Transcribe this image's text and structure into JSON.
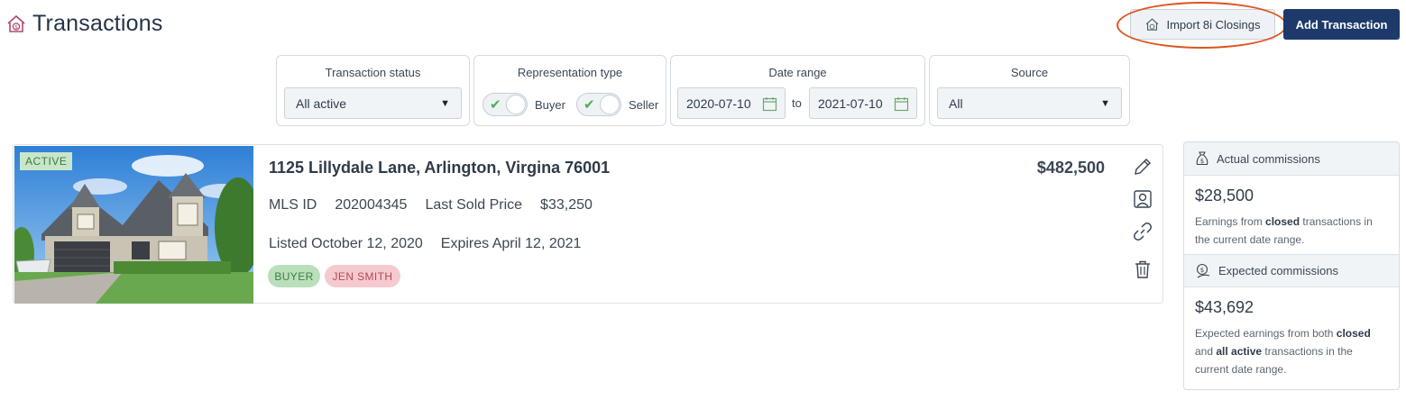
{
  "header": {
    "title": "Transactions",
    "import_label": "Import 8i Closings",
    "add_label": "Add Transaction"
  },
  "filters": {
    "status": {
      "label": "Transaction status",
      "value": "All active"
    },
    "representation": {
      "label": "Representation type",
      "buyer_label": "Buyer",
      "seller_label": "Seller",
      "buyer_on": true,
      "seller_on": true
    },
    "date_range": {
      "label": "Date range",
      "from": "2020-07-10",
      "to_word": "to",
      "to": "2021-07-10"
    },
    "source": {
      "label": "Source",
      "value": "All"
    }
  },
  "transaction": {
    "status": "ACTIVE",
    "address": "1125 Lillydale Lane, Arlington, Virgina 76001",
    "price": "$482,500",
    "mls_label": "MLS ID",
    "mls_id": "202004345",
    "last_sold_label": "Last Sold Price",
    "last_sold": "$33,250",
    "listed": "Listed October 12, 2020",
    "expires": "Expires April 12, 2021",
    "chips": [
      "BUYER",
      "JEN SMITH"
    ]
  },
  "commissions": {
    "actual": {
      "title": "Actual commissions",
      "amount": "$28,500",
      "desc_pre": "Earnings from ",
      "desc_bold": "closed",
      "desc_post": " transactions in the current date range."
    },
    "expected": {
      "title": "Expected commissions",
      "amount": "$43,692",
      "desc_pre": "Expected earnings from both ",
      "desc_bold1": "closed",
      "desc_mid": " and ",
      "desc_bold2": "all active",
      "desc_post": " transactions in the current date range."
    }
  },
  "colors": {
    "primary": "#1d3a6b",
    "highlight": "#e0541f",
    "active_tag": "#c8e6c9",
    "buyer_chip": "#b9dfbb",
    "agent_chip": "#f6c9cf"
  }
}
